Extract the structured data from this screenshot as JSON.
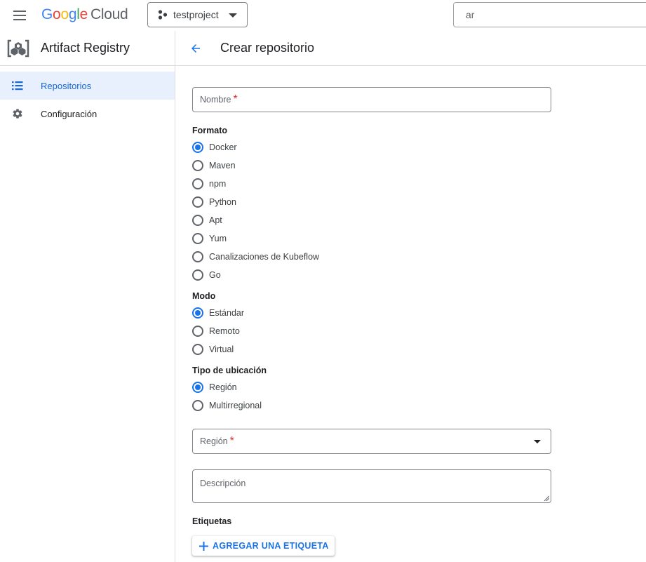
{
  "topbar": {
    "logo": {
      "g1": "G",
      "o1": "o",
      "o2": "o",
      "g2": "g",
      "l": "l",
      "e": "e",
      "cloud": "Cloud"
    },
    "project": "testproject",
    "search_value": "ar"
  },
  "sidebar": {
    "product_title": "Artifact Registry",
    "items": [
      {
        "label": "Repositorios",
        "icon": "list-icon",
        "active": true
      },
      {
        "label": "Configuración",
        "icon": "gear-icon",
        "active": false
      }
    ]
  },
  "page": {
    "title": "Crear repositorio",
    "name_field": {
      "label": "Nombre",
      "required_mark": "*"
    },
    "formato": {
      "label": "Formato",
      "options": [
        "Docker",
        "Maven",
        "npm",
        "Python",
        "Apt",
        "Yum",
        "Canalizaciones de Kubeflow",
        "Go"
      ],
      "selected": "Docker"
    },
    "modo": {
      "label": "Modo",
      "options": [
        "Estándar",
        "Remoto",
        "Virtual"
      ],
      "selected": "Estándar"
    },
    "ubicacion": {
      "label": "Tipo de ubicación",
      "options": [
        "Región",
        "Multirregional"
      ],
      "selected": "Región"
    },
    "region_field": {
      "label": "Región",
      "required_mark": "*"
    },
    "description_field": {
      "label": "Descripción"
    },
    "labels_section": {
      "label": "Etiquetas",
      "add_button": "AGREGAR UNA ETIQUETA"
    }
  },
  "colors": {
    "accent": "#1a73e8",
    "active_nav_bg": "#e8f0fe",
    "required": "#d93025"
  }
}
